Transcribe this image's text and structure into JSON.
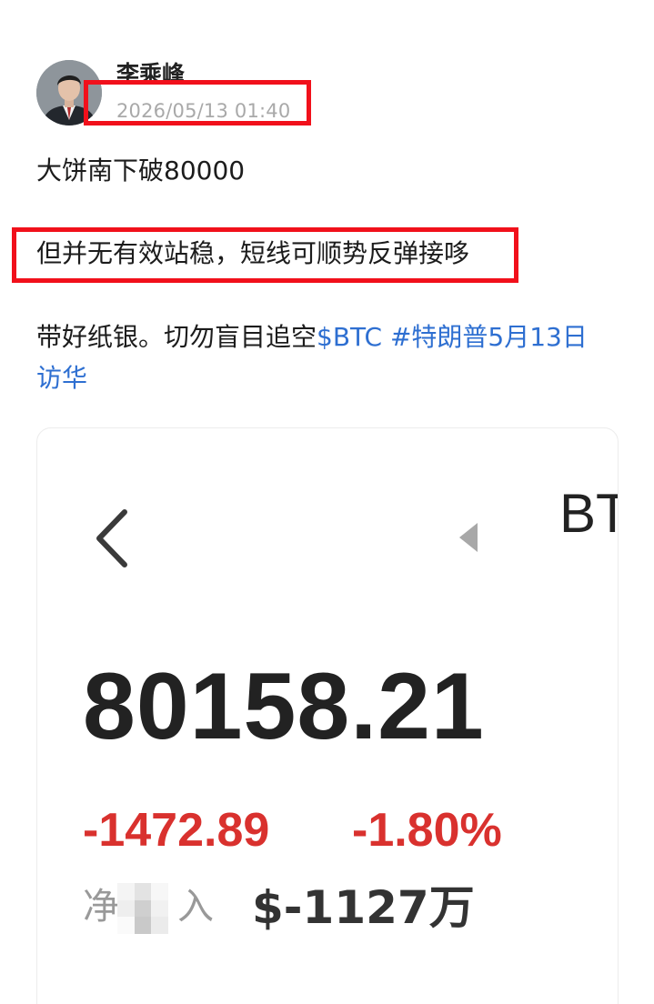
{
  "post": {
    "author_name": "李乘峰",
    "timestamp": "2026/05/13 01:40",
    "lines": [
      "大饼南下破80000",
      "但并无有效站稳，短线可顺势反弹接哆"
    ],
    "line3_text": "带好纸银。切勿盲目追空",
    "line3_link": "$BTC #特朗普5月13日",
    "line4_link": "访华",
    "link_color": "#2e6fd1",
    "highlight_color": "#f1101b"
  },
  "card": {
    "icons": [
      "back-arrow-icon",
      "triangle-left-icon"
    ],
    "symbol": "BT",
    "price": "80158.21",
    "change_abs": "-1472.89",
    "change_pct": "-1.80%",
    "negative_color": "#d9312e",
    "inflow_label_start": "净",
    "inflow_label_end": "入",
    "inflow_value": "$-1127万"
  }
}
